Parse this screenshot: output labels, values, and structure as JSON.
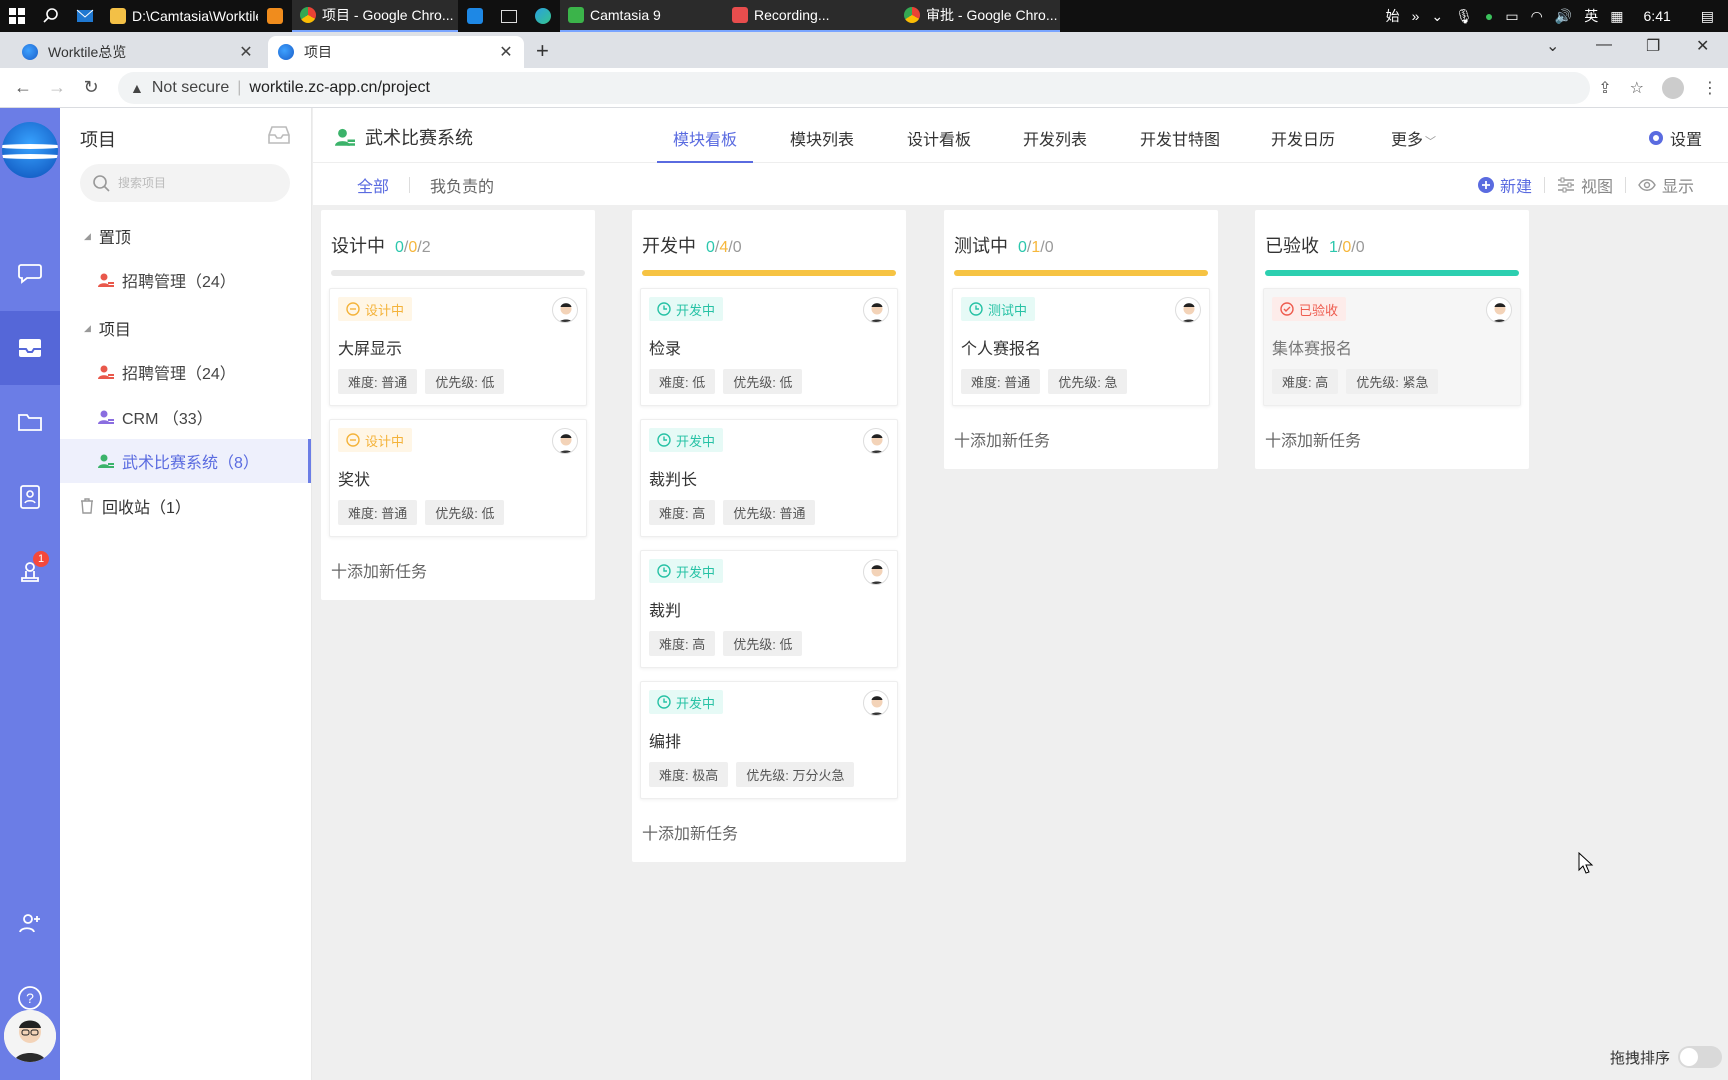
{
  "taskbar": {
    "apps": [
      {
        "label": "D:\\Camtasia\\Worktile",
        "icon": "folder-icon",
        "color": "#f3c046"
      },
      {
        "label": "项目 - Google Chro...",
        "icon": "chrome-icon",
        "color": "#e94235"
      },
      {
        "label": "Camtasia 9",
        "icon": "camtasia-icon",
        "color": "#3bb44a"
      },
      {
        "label": "Recording...",
        "icon": "recording-icon",
        "color": "#e84d4d"
      },
      {
        "label": "审批 - Google Chro...",
        "icon": "chrome-icon",
        "color": "#e94235"
      }
    ],
    "tray": {
      "ime_short": "始",
      "ime_lang": "英",
      "time": "6:41"
    }
  },
  "browser": {
    "tabs": [
      {
        "title": "Worktile总览",
        "active": false
      },
      {
        "title": "项目",
        "active": true
      }
    ],
    "address": {
      "security": "Not secure",
      "url": "worktile.zc-app.cn/project"
    }
  },
  "rail": {
    "items": [
      "chat-icon",
      "inbox-icon",
      "folder-icon",
      "contacts-icon",
      "approval-icon"
    ],
    "badge_count": "1",
    "bottom": [
      "add-user-icon",
      "help-icon"
    ]
  },
  "sidebar": {
    "title": "项目",
    "search_placeholder": "搜索项目",
    "pinned_group": "置顶",
    "pinned_items": [
      {
        "label": "招聘管理（24）",
        "icon_color": "#e9584b"
      }
    ],
    "projects_group": "项目",
    "project_items": [
      {
        "label": "招聘管理（24）",
        "icon_color": "#e9584b",
        "active": false
      },
      {
        "label": "CRM （33）",
        "icon_color": "#8a6de0",
        "active": false
      },
      {
        "label": "武术比赛系统（8）",
        "icon_color": "#3bb36a",
        "active": true
      }
    ],
    "trash": "回收站（1）"
  },
  "header": {
    "project_name": "武术比赛系统",
    "tabs": [
      "模块看板",
      "模块列表",
      "设计看板",
      "开发列表",
      "开发甘特图",
      "开发日历",
      "更多"
    ],
    "active_tab": "模块看板",
    "settings": "设置"
  },
  "subheader": {
    "filters": [
      "全部",
      "我负责的"
    ],
    "active_filter": "全部",
    "actions": {
      "new": "新建",
      "view": "视图",
      "display": "显示"
    }
  },
  "colors": {
    "accent": "#5a6be0",
    "rail": "#6b7de6",
    "done": "#2cc7ad",
    "progress": "#f6b73c"
  },
  "board": {
    "add_task_label": "十添加新任务",
    "columns": [
      {
        "title": "设计中",
        "done": "0",
        "progress": "0",
        "todo": "2",
        "bar_color": "#e8e8e8",
        "cards": [
          {
            "status": "设计中",
            "status_type": "design",
            "title": "大屏显示",
            "difficulty": "难度: 普通",
            "priority": "优先级: 低"
          },
          {
            "status": "设计中",
            "status_type": "design",
            "title": "奖状",
            "difficulty": "难度: 普通",
            "priority": "优先级: 低"
          }
        ]
      },
      {
        "title": "开发中",
        "done": "0",
        "progress": "4",
        "todo": "0",
        "bar_color": "#f6c343",
        "cards": [
          {
            "status": "开发中",
            "status_type": "dev",
            "title": "检录",
            "difficulty": "难度: 低",
            "priority": "优先级: 低"
          },
          {
            "status": "开发中",
            "status_type": "dev",
            "title": "裁判长",
            "difficulty": "难度: 高",
            "priority": "优先级: 普通"
          },
          {
            "status": "开发中",
            "status_type": "dev",
            "title": "裁判",
            "difficulty": "难度: 高",
            "priority": "优先级: 低"
          },
          {
            "status": "开发中",
            "status_type": "dev",
            "title": "编排",
            "difficulty": "难度: 极高",
            "priority": "优先级: 万分火急"
          }
        ]
      },
      {
        "title": "测试中",
        "done": "0",
        "progress": "1",
        "todo": "0",
        "bar_color": "#f6c343",
        "cards": [
          {
            "status": "测试中",
            "status_type": "test",
            "title": "个人赛报名",
            "difficulty": "难度: 普通",
            "priority": "优先级: 急"
          }
        ]
      },
      {
        "title": "已验收",
        "done": "1",
        "progress": "0",
        "todo": "0",
        "bar_color": "#2ccfb0",
        "cards": [
          {
            "status": "已验收",
            "status_type": "done",
            "title": "集体赛报名",
            "difficulty": "难度: 高",
            "priority": "优先级: 紧急"
          }
        ]
      }
    ]
  },
  "footer": {
    "drag_sort": "拖拽排序"
  }
}
